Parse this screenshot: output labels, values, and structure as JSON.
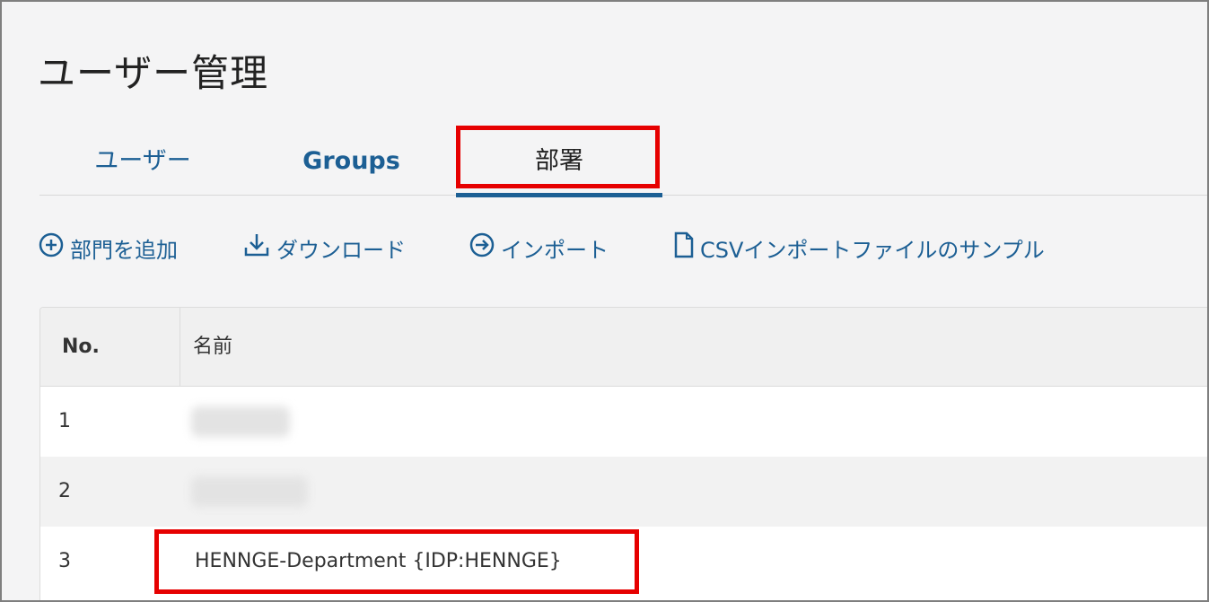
{
  "page": {
    "title": "ユーザー管理"
  },
  "tabs": {
    "users": "ユーザー",
    "groups": "Groups",
    "departments": "部署"
  },
  "toolbar": {
    "add_department": "部門を追加",
    "download": "ダウンロード",
    "import": "インポート",
    "csv_sample": "CSVインポートファイルのサンプル"
  },
  "table": {
    "headers": {
      "no": "No.",
      "name": "名前"
    },
    "rows": [
      {
        "no": "1",
        "name": ""
      },
      {
        "no": "2",
        "name": ""
      },
      {
        "no": "3",
        "name": "HENNGE-Department {IDP:HENNGE}"
      }
    ]
  },
  "colors": {
    "accent": "#1c5f94",
    "highlight": "#e60000"
  }
}
